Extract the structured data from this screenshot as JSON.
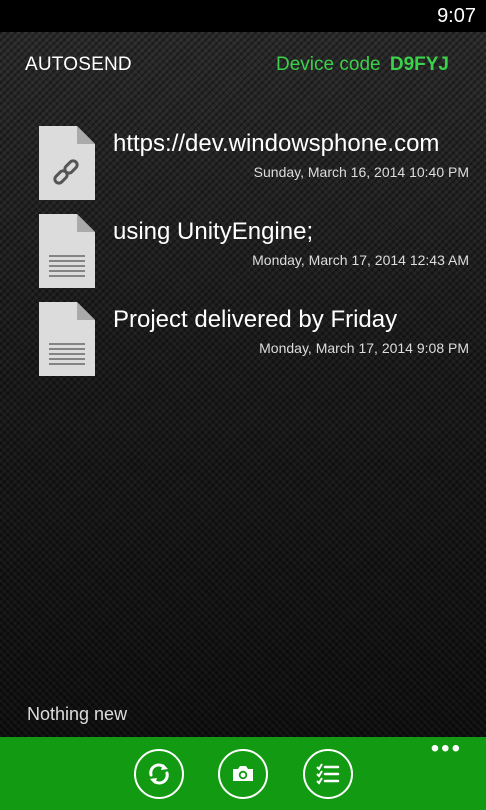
{
  "status_bar": {
    "time": "9:07"
  },
  "header": {
    "app_title": "AUTOSEND",
    "device_code_label": "Device code",
    "device_code_value": "D9FYJ"
  },
  "items": [
    {
      "icon": "link-document-icon",
      "title": "https://dev.windowsphone.com",
      "date": "Sunday, March 16, 2014 10:40 PM"
    },
    {
      "icon": "text-document-icon",
      "title": "using UnityEngine;",
      "date": "Monday, March 17, 2014 12:43 AM"
    },
    {
      "icon": "text-document-icon",
      "title": "Project delivered by Friday",
      "date": "Monday, March 17, 2014 9:08 PM"
    }
  ],
  "status": {
    "message": "Nothing new"
  },
  "app_bar": {
    "buttons": [
      "refresh-icon",
      "camera-icon",
      "list-icon"
    ],
    "more": "•••",
    "color": "#129a12"
  },
  "colors": {
    "accent": "#3bd14a",
    "app_bar": "#129a12"
  }
}
